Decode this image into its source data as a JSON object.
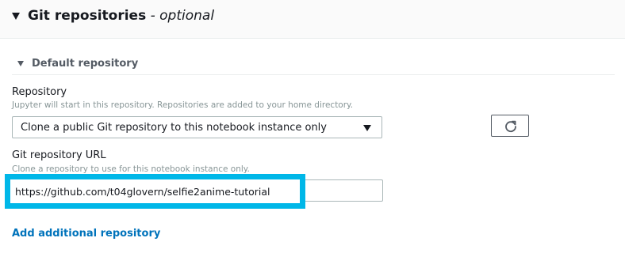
{
  "header": {
    "title": "Git repositories",
    "optional_suffix": " - optional"
  },
  "section": {
    "title": "Default repository"
  },
  "repository": {
    "label": "Repository",
    "description": "Jupyter will start in this repository. Repositories are added to your home directory.",
    "selected_value": "Clone a public Git repository to this notebook instance only"
  },
  "git_url": {
    "label": "Git repository URL",
    "description": "Clone a repository to use for this notebook instance only.",
    "value": "https://github.com/t04glovern/selfie2anime-tutorial"
  },
  "actions": {
    "add_repository": "Add additional repository"
  },
  "icons": {
    "header_toggle": "caret-down-icon",
    "section_toggle": "caret-down-icon",
    "select_caret": "caret-down-icon",
    "refresh": "refresh-icon"
  },
  "colors": {
    "highlight": "#00b7e8",
    "link": "#0073bb"
  }
}
